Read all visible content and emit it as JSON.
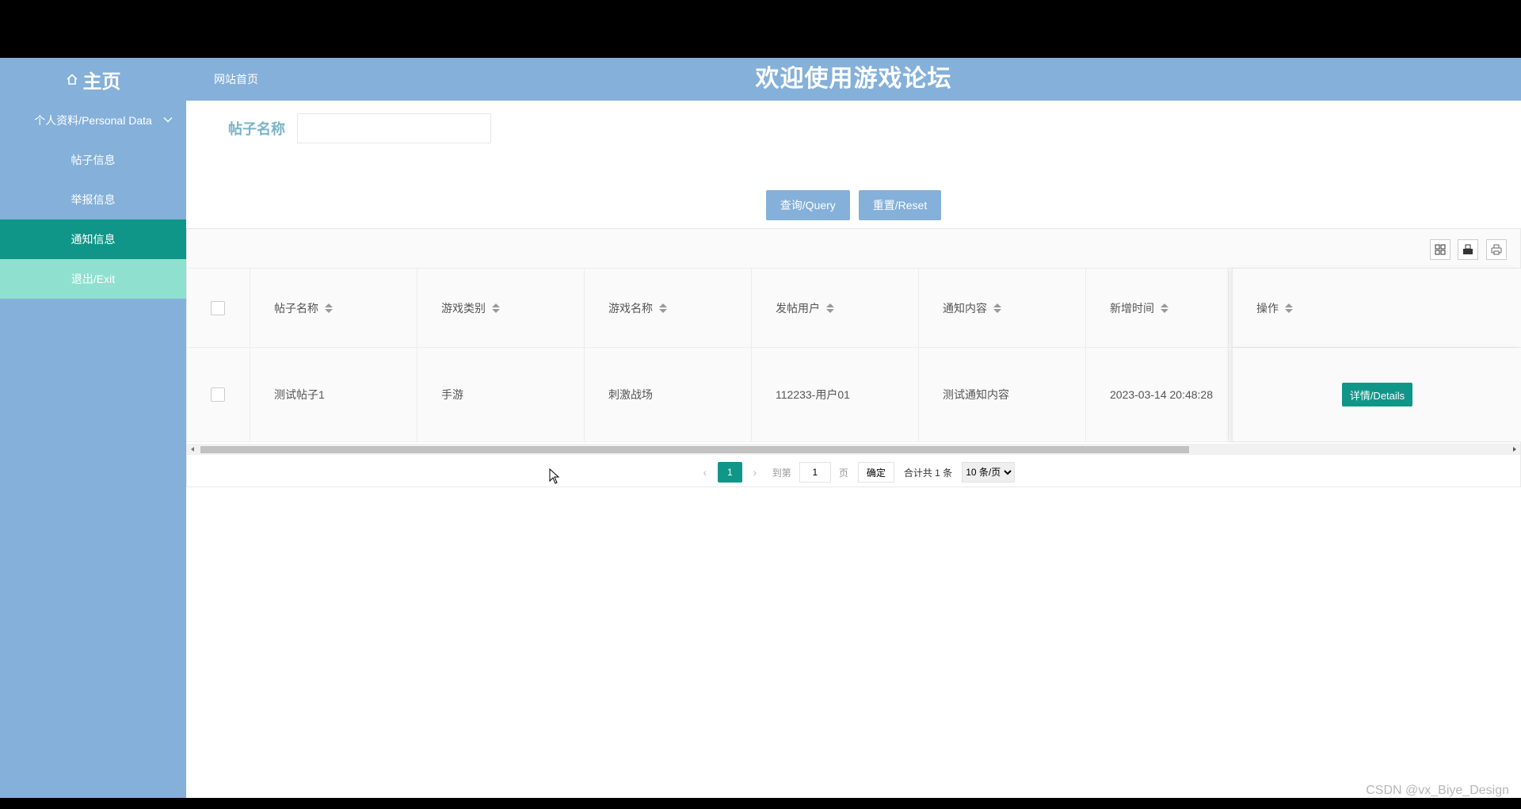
{
  "header": {
    "home_label": "主页",
    "site_link": "网站首页",
    "title": "欢迎使用游戏论坛"
  },
  "sidebar": {
    "items": [
      {
        "label": "个人资料/Personal Data",
        "state": "collapsed"
      },
      {
        "label": "帖子信息"
      },
      {
        "label": "举报信息"
      },
      {
        "label": "通知信息",
        "state": "active"
      },
      {
        "label": "退出/Exit"
      }
    ]
  },
  "search": {
    "label": "帖子名称",
    "value": "",
    "query_button": "查询/Query",
    "reset_button": "重置/Reset"
  },
  "table": {
    "columns": [
      "帖子名称",
      "游戏类别",
      "游戏名称",
      "发帖用户",
      "通知内容",
      "新增时间",
      "操作"
    ],
    "rows": [
      {
        "post_name": "测试帖子1",
        "game_category": "手游",
        "game_name": "刺激战场",
        "user": "112233-用户01",
        "content": "测试通知内容",
        "time": "2023-03-14 20:48:28",
        "action": "详情/Details"
      }
    ]
  },
  "pager": {
    "current_page": "1",
    "goto_label": "到第",
    "goto_value": "1",
    "page_unit": "页",
    "confirm": "确定",
    "total": "合计共 1 条",
    "page_size": "10 条/页"
  },
  "watermark": "CSDN @vx_Biye_Design",
  "colors": {
    "primary": "#84b0d9",
    "accent": "#0f9688",
    "exit_bg": "#8fe0cf",
    "label": "#7ab3c7"
  }
}
